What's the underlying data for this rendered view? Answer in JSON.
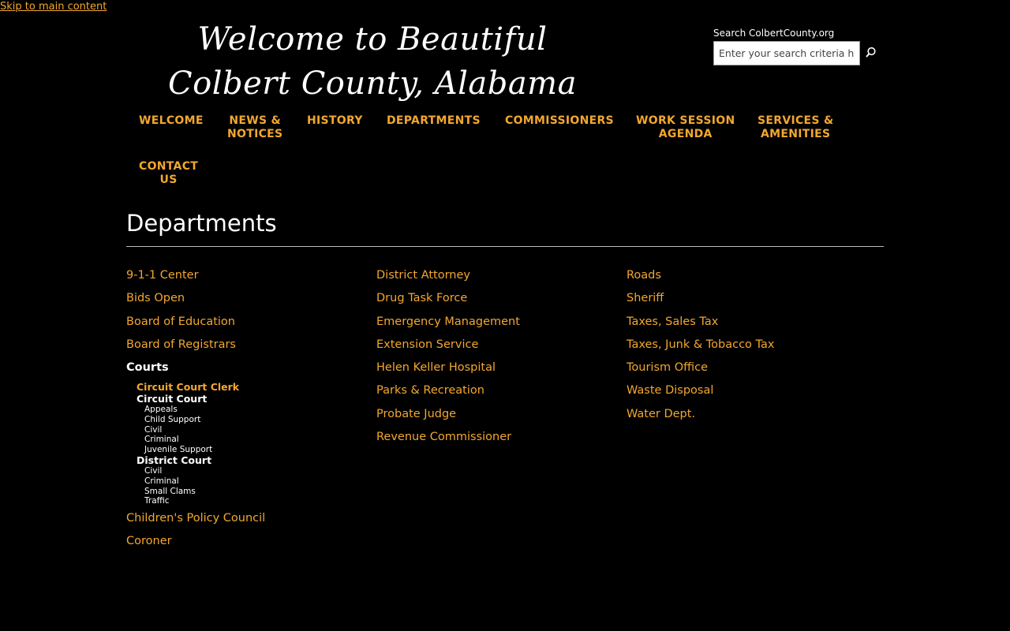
{
  "skip_link": "Skip to main content",
  "header": {
    "title_line1": "Welcome to Beautiful",
    "title_line2": "Colbert County, Alabama",
    "search_label": "Search ColbertCounty.org",
    "search_placeholder": "Enter your search criteria here",
    "search_icon": "search-icon"
  },
  "nav": {
    "welcome": "WELCOME",
    "news_1": "NEWS &",
    "news_2": "NOTICES",
    "history": "HISTORY",
    "departments": "DEPARTMENTS",
    "commissioners": "COMMISSIONERS",
    "work_1": "WORK SESSION",
    "work_2": "AGENDA",
    "services_1": "SERVICES &",
    "services_2": "AMENITIES",
    "contact_1": "CONTACT",
    "contact_2": "US"
  },
  "page_title": "Departments",
  "col1": {
    "l1": "9-1-1 Center",
    "l2": "Bids Open",
    "l3": "Board of Education",
    "l4": "Board of Registrars",
    "courts": "Courts",
    "circuit_clerk": "Circuit Court Clerk",
    "circuit_court": "Circuit Court",
    "cc_appeals": "Appeals",
    "cc_child": "Child Support",
    "cc_civil": "Civil",
    "cc_criminal": "Criminal",
    "cc_juvenile": "Juvenile Support",
    "district_court": "District Court",
    "dc_civil": "Civil",
    "dc_criminal": "Criminal",
    "dc_small": "Small Clams",
    "dc_traffic": "Traffic",
    "l5": "Children's Policy Council",
    "l6": "Coroner"
  },
  "col2": {
    "l1": "District Attorney",
    "l2": "Drug Task Force",
    "l3": "Emergency Management",
    "l4": "Extension Service",
    "l5": "Helen Keller Hospital",
    "l6": "Parks & Recreation",
    "l7": "Probate Judge",
    "l8": "Revenue Commissioner"
  },
  "col3": {
    "l1": "Roads",
    "l2": "Sheriff",
    "l3": "Taxes, Sales Tax",
    "l4": "Taxes, Junk & Tobacco Tax",
    "l5": "Tourism Office",
    "l6": "Waste Disposal",
    "l7": "Water Dept."
  },
  "colors": {
    "background": "#000000",
    "link": "#f3a72f",
    "text": "#ffffff"
  }
}
